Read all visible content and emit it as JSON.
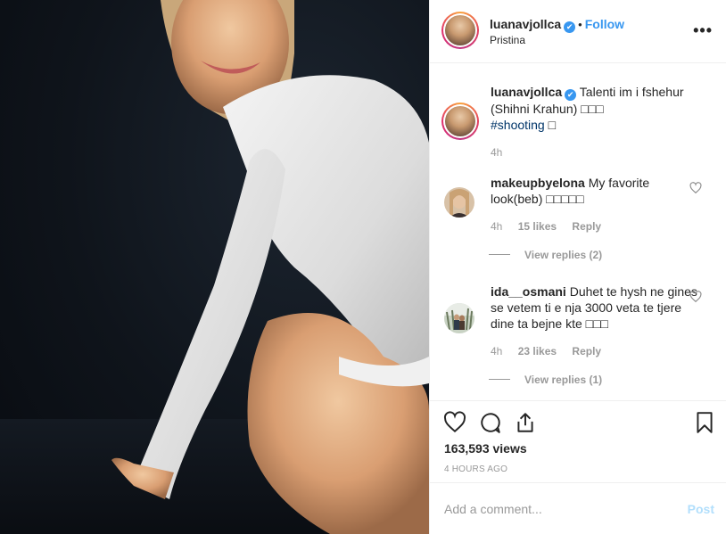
{
  "post": {
    "username": "luanavjollca",
    "verified_mark": "✔",
    "separator": "•",
    "follow_label": "Follow",
    "location": "Pristina",
    "more_label": "•••"
  },
  "caption": {
    "username": "luanavjollca",
    "text": "Talenti im i fshehur (Shihni Krahun) □□□",
    "hashtag": "#shooting",
    "hashtag_suffix": "□",
    "age": "4h"
  },
  "comments": [
    {
      "username": "makeupbyelona",
      "text": "My favorite look(beb) □□□□□",
      "age": "4h",
      "likes": "15 likes",
      "reply_label": "Reply",
      "view_replies": "View replies (2)"
    },
    {
      "username": "ida__osmani",
      "text": "Duhet te hysh ne gines se vetem ti e nja 3000 veta te tjere dine ta bejne kte □□□",
      "age": "4h",
      "likes": "23 likes",
      "reply_label": "Reply",
      "view_replies": "View replies (1)"
    }
  ],
  "icons": [
    "heart-icon",
    "comment-icon",
    "share-icon",
    "bookmark-icon",
    "more-options-icon",
    "verified-badge-icon"
  ],
  "stats": {
    "views": "163,593 views",
    "time_ago": "4 HOURS AGO"
  },
  "add_comment": {
    "placeholder": "Add a comment...",
    "post_label": "Post"
  },
  "colors": {
    "link_blue": "#3897f0",
    "hashtag": "#003569",
    "muted": "#999999",
    "post_disabled": "#b2dffc"
  }
}
